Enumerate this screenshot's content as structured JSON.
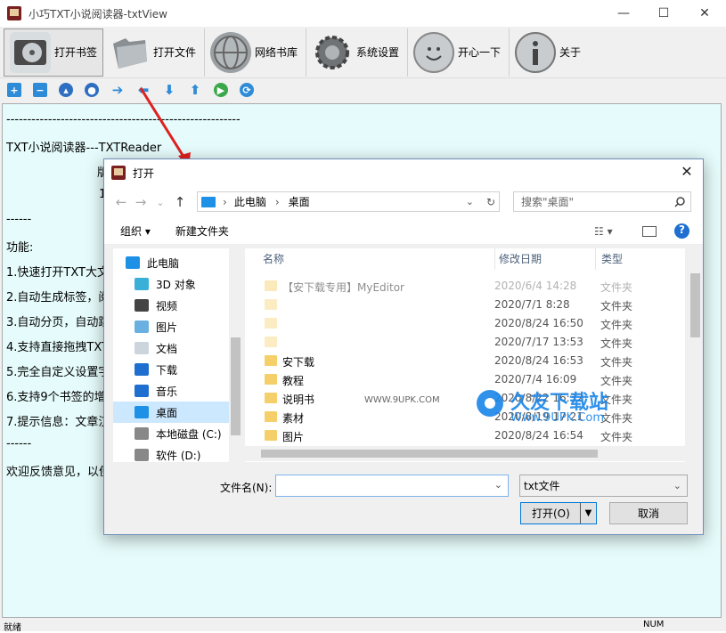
{
  "window": {
    "title": "小巧TXT小说阅读器-txtView",
    "minimize": "—",
    "maximize": "☐",
    "close": "✕"
  },
  "toolbar": [
    {
      "label": "打开书签",
      "icon": "bookmark-drive-icon"
    },
    {
      "label": "打开文件",
      "icon": "folder-icon"
    },
    {
      "label": "网络书库",
      "icon": "globe-icon"
    },
    {
      "label": "系统设置",
      "icon": "gear-icon"
    },
    {
      "label": "开心一下",
      "icon": "smiley-icon"
    },
    {
      "label": "关于",
      "icon": "info-icon"
    }
  ],
  "content": {
    "separator": "--------------------------------------------------------",
    "lines": [
      "TXT小说阅读器---TXTReader",
      "版",
      "1",
      "------",
      "功能:",
      "1.快速打开TXT大文",
      "2.自动生成标签，阅",
      "3.自动分页，自动跳",
      "4.支持直接拖拽TXT",
      "5.完全自定义设置字",
      "6.支持9个书签的增",
      "7.提示信息：文章汉",
      "------",
      "欢迎反馈意见，以便"
    ]
  },
  "status": {
    "left": "就绪",
    "right": "NUM"
  },
  "dialog": {
    "title": "打开",
    "close": "✕",
    "nav": {
      "back": "←",
      "forward": "→",
      "dropdown": "⌄",
      "up": "↑"
    },
    "breadcrumb": [
      "此电脑",
      "桌面"
    ],
    "breadcrumb_sep": "›",
    "refresh": "↻",
    "search_placeholder": "搜索\"桌面\"",
    "organize": "组织 ▾",
    "new_folder": "新建文件夹",
    "help": "?",
    "nav_items": [
      "此电脑",
      "3D 对象",
      "视频",
      "图片",
      "文档",
      "下载",
      "音乐",
      "桌面",
      "本地磁盘 (C:)",
      "软件 (D:)"
    ],
    "columns": {
      "name": "名称",
      "date": "修改日期",
      "type": "类型"
    },
    "files": [
      {
        "name": "【安下载专用】MyEditor",
        "date": "2020/6/4 14:28",
        "type": "文件夹"
      },
      {
        "name": "",
        "date": "2020/7/1 8:28",
        "type": "文件夹"
      },
      {
        "name": "",
        "date": "2020/8/24 16:50",
        "type": "文件夹"
      },
      {
        "name": "",
        "date": "2020/7/17 13:53",
        "type": "文件夹"
      },
      {
        "name": "安下载",
        "date": "2020/8/24 16:53",
        "type": "文件夹"
      },
      {
        "name": "教程",
        "date": "2020/7/4 16:09",
        "type": "文件夹"
      },
      {
        "name": "说明书",
        "date": "2020/8/22 16:32",
        "type": "文件夹"
      },
      {
        "name": "素材",
        "date": "2020/8/19 17:21",
        "type": "文件夹"
      },
      {
        "name": "图片",
        "date": "2020/8/24 16:54",
        "type": "文件夹"
      }
    ],
    "filename_label": "文件名(N):",
    "filename_value": "",
    "filetype_value": "txt文件",
    "open_button": "打开(O)",
    "cancel_button": "取消"
  },
  "watermark": {
    "brand": "久友下载站",
    "url": "Www.9UPK.Com",
    "domain": "WWW.9UPK.COM"
  },
  "colors": {
    "content_bg": "#e6fbfb",
    "accent": "#0078d7",
    "selected": "#cce8ff",
    "folder": "#f5cf6a"
  }
}
